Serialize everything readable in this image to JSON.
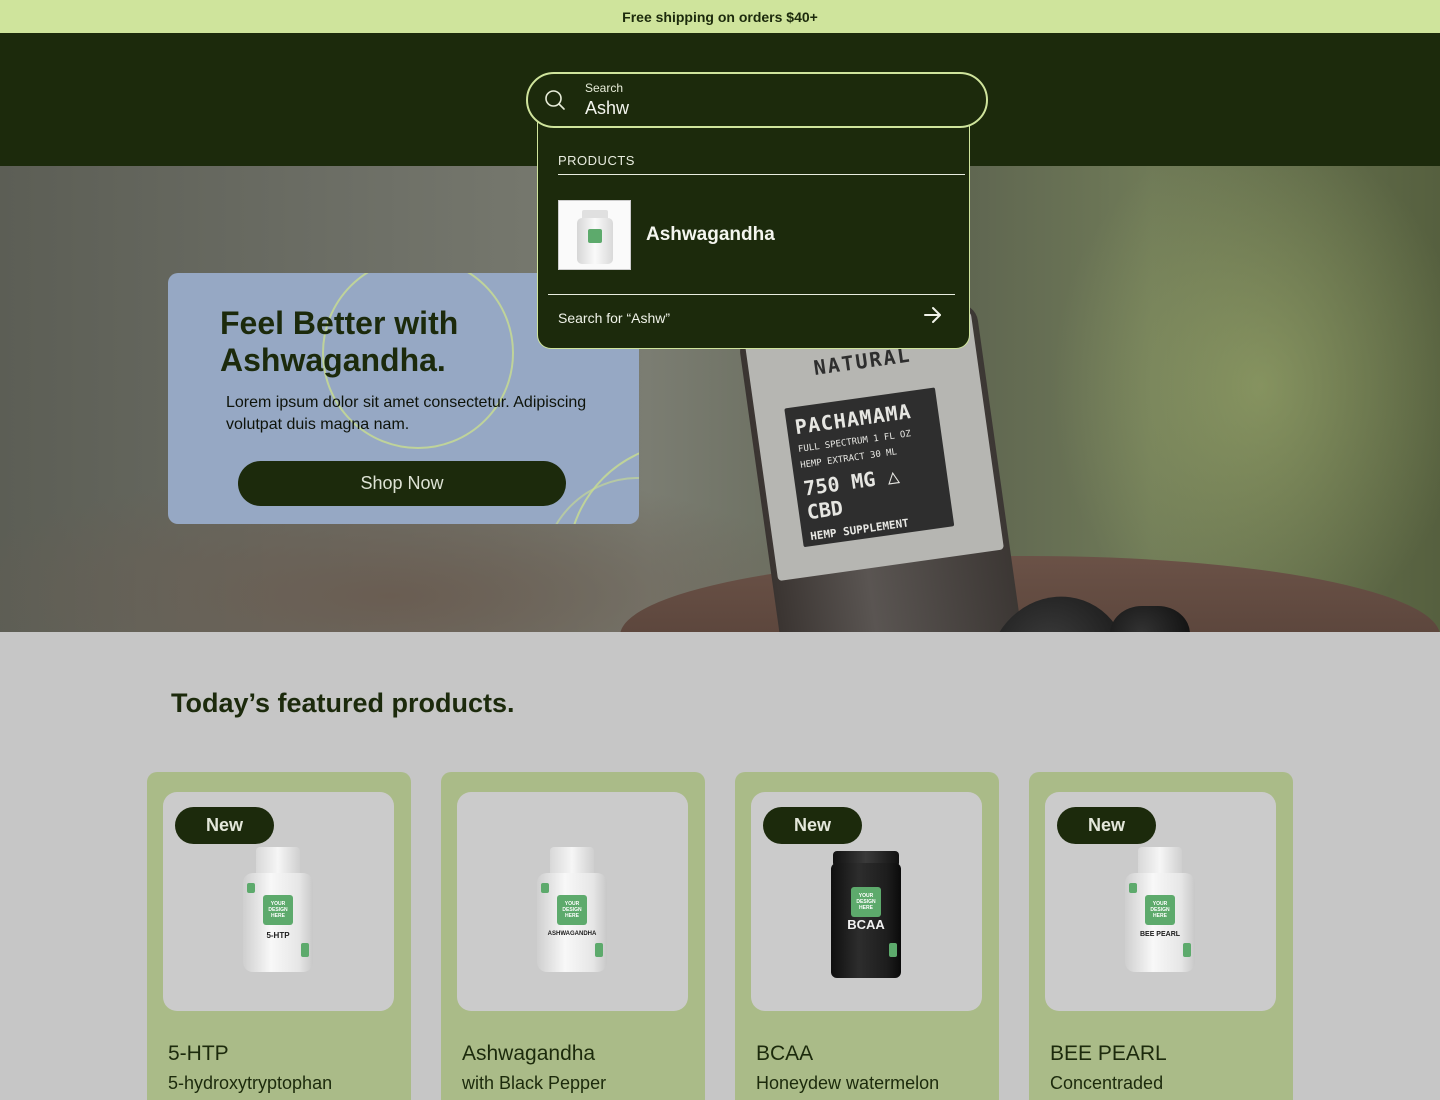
{
  "announcement": {
    "text": "Free shipping on orders $40+"
  },
  "search": {
    "label": "Search",
    "value": "Ashw",
    "results_heading": "PRODUCTS",
    "results": [
      {
        "name": "Ashwagandha"
      }
    ],
    "search_for_text": "Search for “Ashw”"
  },
  "hero": {
    "title": "Feel Better with Ashwagandha.",
    "text": "Lorem ipsum dolor sit amet consectetur. Adipiscing volutpat duis magna nam.",
    "cta": "Shop Now",
    "bottle": {
      "natural": "NATURAL",
      "brand": "PACHAMAMA",
      "line1": "FULL SPECTRUM 1 FL OZ",
      "line2": "HEMP EXTRACT 30 ML",
      "mg": "750 MG △ CBD",
      "supplement": "HEMP SUPPLEMENT"
    }
  },
  "featured": {
    "title": "Today’s featured products.",
    "products": [
      {
        "badge": "New",
        "name": "5-HTP",
        "subtitle": "5-hydroxytryptophan",
        "label": "5-HTP"
      },
      {
        "badge": "",
        "name": "Ashwagandha",
        "subtitle": "with Black Pepper",
        "label": "ASHWAGANDHA"
      },
      {
        "badge": "New",
        "name": "BCAA",
        "subtitle": "Honeydew watermelon",
        "label": "BCAA"
      },
      {
        "badge": "New",
        "name": "BEE PEARL",
        "subtitle": "Concentraded",
        "label": "BEE PEARL"
      }
    ],
    "patch_text": "YOUR DESIGN HERE"
  },
  "colors": {
    "brand_dark": "#1c2a0c",
    "accent_light": "#cfe49c",
    "card_green": "#aabb88",
    "hero_card_blue": "#96a8c4"
  },
  "icons": {
    "search": "search-icon",
    "arrow": "arrow-right-icon"
  }
}
